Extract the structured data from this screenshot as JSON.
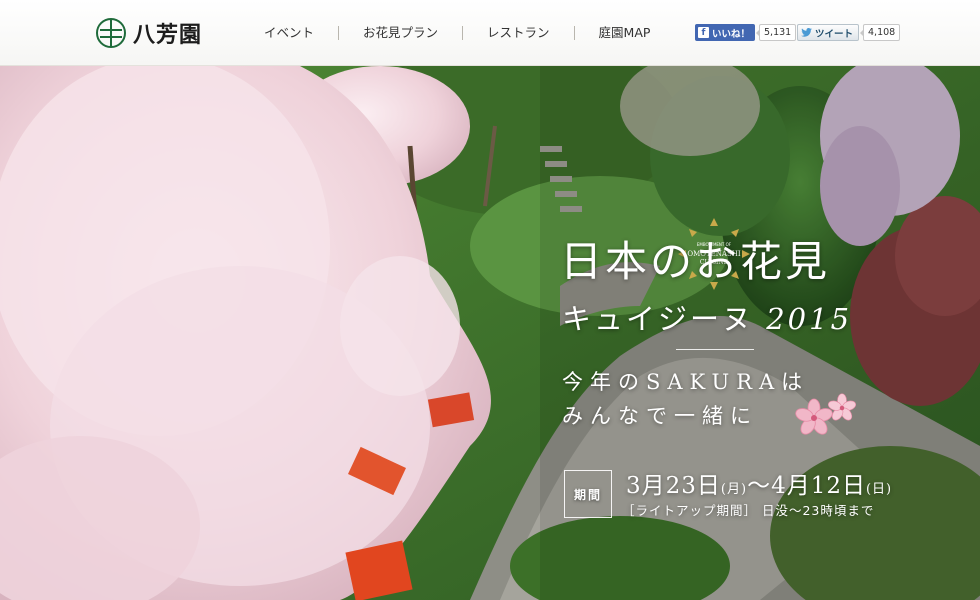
{
  "header": {
    "logo_text": "八芳園",
    "nav": [
      {
        "label": "イベント"
      },
      {
        "label": "お花見プラン"
      },
      {
        "label": "レストラン"
      },
      {
        "label": "庭園MAP"
      }
    ],
    "facebook": {
      "label": "いいね！",
      "count": "5,131",
      "icon": "facebook-icon",
      "color": "#4267b2"
    },
    "twitter": {
      "label": "ツイート",
      "count": "4,108",
      "icon": "twitter-bird-icon"
    }
  },
  "hero": {
    "badge": {
      "line1": "EMBODIMENT OF",
      "line2": "OMOTENASHI",
      "line3": "CUISINE"
    },
    "title_line1": "日本のお花見",
    "title_line2_jp": "キュイジーヌ",
    "title_line2_year": "2015",
    "subtitle_line1": "今年のSAKURAは",
    "subtitle_line2": "みんなで一緒に",
    "period_label": "期間",
    "start_date": "3月23日",
    "start_dow": "(月)",
    "date_sep": "～",
    "end_date": "4月12日",
    "end_dow": "(日)",
    "lightup_text": "［ライトアップ期間］ 日没～23時頃まで"
  },
  "colors": {
    "accent_gold": "#c9a94a",
    "logo_green": "#1f6b3b"
  }
}
